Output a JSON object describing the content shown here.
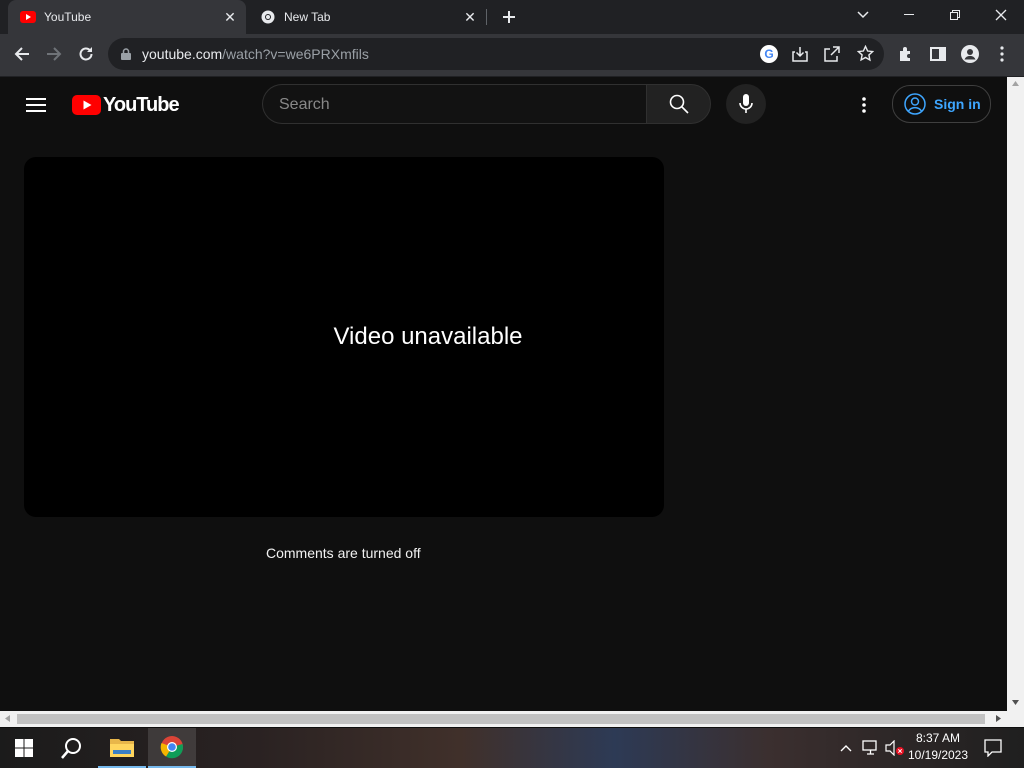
{
  "browser": {
    "tabs": [
      {
        "title": "YouTube",
        "active": true,
        "icon": "youtube-favicon"
      },
      {
        "title": "New Tab",
        "active": false,
        "icon": "chrome-icon"
      }
    ],
    "url_host": "youtube.com",
    "url_path": "/watch?v=we6PRXmfils"
  },
  "youtube": {
    "logo_text": "YouTube",
    "search_placeholder": "Search",
    "sign_in": "Sign in"
  },
  "player": {
    "message": "Video unavailable"
  },
  "comments_text": "Comments are turned off",
  "taskbar": {
    "time": "8:37 AM",
    "date": "10/19/2023"
  },
  "colors": {
    "youtube_red": "#ff0000",
    "link_blue": "#3ea6ff",
    "page_bg": "#0f0f0f"
  }
}
